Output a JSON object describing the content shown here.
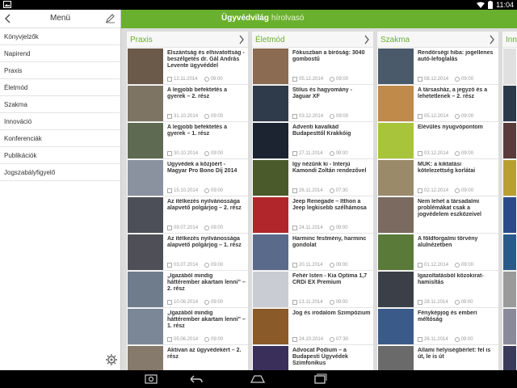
{
  "status": {
    "time": "11:04"
  },
  "drawer": {
    "title": "Menü",
    "items": [
      "Könyvjelzők",
      "Napirend",
      "Praxis",
      "Életmód",
      "Szakma",
      "Innováció",
      "Konferenciák",
      "Publikációk",
      "Jogszabályfigyelő"
    ]
  },
  "header": {
    "title": "Ügyvédvilág",
    "subtitle": "hírolvasó"
  },
  "columns": [
    {
      "title": "Praxis",
      "articles": [
        {
          "title": "Elszántság és elhivatottság - beszélgetés dr. Gál András Levente ügyvéddel",
          "date": "12.11.2014",
          "time": "09:00",
          "thumb": "#6b5a4a"
        },
        {
          "title": "A legjobb befektetés a gyerek – 2. rész",
          "date": "31.10.2014",
          "time": "09:00",
          "thumb": "#7d7463"
        },
        {
          "title": "A legjobb befektetés a gyerek – 1. rész",
          "date": "30.10.2014",
          "time": "09:00",
          "thumb": "#5e6a52"
        },
        {
          "title": "Ügyvédek a közjóért - Magyar Pro Bono Díj 2014",
          "date": "15.10.2014",
          "time": "09:00",
          "thumb": "#8a92a0"
        },
        {
          "title": "Az ítélkezés nyilvánossága alapvető polgárjog – 2. rész",
          "date": "09.07.2014",
          "time": "09:00",
          "thumb": "#4c4e58"
        },
        {
          "title": "Az ítélkezés nyilvánossága alapvető polgárjog – 1. rész",
          "date": "03.07.2014",
          "time": "09:00",
          "thumb": "#4f5057"
        },
        {
          "title": "„Igazából mindig háttérember akartam lenni” – 2. rész",
          "date": "10.06.2014",
          "time": "09:00",
          "thumb": "#6f7c8c"
        },
        {
          "title": "„Igazából mindig háttérember akartam lenni” – 1. rész",
          "date": "05.06.2014",
          "time": "09:00",
          "thumb": "#7b8796"
        },
        {
          "title": "Aktivan az ügyvédekért – 2. rész",
          "date": "",
          "time": "",
          "thumb": "#857a6c"
        }
      ]
    },
    {
      "title": "Életmód",
      "articles": [
        {
          "title": "Fókuszban a bíróság: 3040 gombostű",
          "date": "05.12.2014",
          "time": "09:00",
          "thumb": "#8b6b52"
        },
        {
          "title": "Stílus és hagyomány - Jaguar XF",
          "date": "03.12.2014",
          "time": "09:00",
          "thumb": "#2f3a4a"
        },
        {
          "title": "Adventi kavalkád Budapesttől Krakkóig",
          "date": "27.11.2014",
          "time": "09:00",
          "thumb": "#1b2430"
        },
        {
          "title": "Így nézünk ki - Interjú Kamondi Zoltán rendezővel",
          "date": "26.11.2014",
          "time": "07:30",
          "thumb": "#4a5a2a"
        },
        {
          "title": "Jeep Renegade – Itthon a Jeep legkisebb szélhámosa",
          "date": "24.11.2014",
          "time": "09:00",
          "thumb": "#b0262a"
        },
        {
          "title": "Harminc festmény, harminc gondolat",
          "date": "20.11.2014",
          "time": "09:00",
          "thumb": "#5a6a8a"
        },
        {
          "title": "Fehér Isten - Kia Optima 1,7 CRDi EX Premium",
          "date": "13.11.2014",
          "time": "09:00",
          "thumb": "#c9ccd2"
        },
        {
          "title": "Jog és irodalom Szimpózium",
          "date": "24.10.2014",
          "time": "07:30",
          "thumb": "#8a5a28"
        },
        {
          "title": "Advocat Podium – a Budapesti Ügyvédek Szimfonikus",
          "date": "",
          "time": "",
          "thumb": "#3a2f5a"
        }
      ]
    },
    {
      "title": "Szakma",
      "articles": [
        {
          "title": "Rendőrségi hiba: jogellenes autó-lefoglalás",
          "date": "08.12.2014",
          "time": "09:00",
          "thumb": "#4a5a6a"
        },
        {
          "title": "A társasház, a jegyző és a lehetetlenek – 2. rész",
          "date": "05.12.2014",
          "time": "09:00",
          "thumb": "#c08a4a"
        },
        {
          "title": "Elévülés nyugvópontom",
          "date": "03.12.2014",
          "time": "09:00",
          "thumb": "#a8c43a"
        },
        {
          "title": "MÜK: a kiktatási kötelezettség korlátai",
          "date": "02.12.2014",
          "time": "09:00",
          "thumb": "#9a8a6a"
        },
        {
          "title": "Nem lehet a társadalmi problémákat csak a jogvédelem eszközeivel kezelni",
          "date": "",
          "time": "",
          "thumb": "#7a6a60"
        },
        {
          "title": "A földforgalmi törvény alulnézetben",
          "date": "01.12.2014",
          "time": "09:00",
          "thumb": "#5a7a3a"
        },
        {
          "title": "Igazoltatásból közokirat-hamisítás",
          "date": "28.11.2014",
          "time": "09:00",
          "thumb": "#3a3f48"
        },
        {
          "title": "Fényképjog és emberi méltóság",
          "date": "26.11.2014",
          "time": "09:00",
          "thumb": "#3a5a8a"
        },
        {
          "title": "Állami helyiségbérlet: fel is út, le is út",
          "date": "",
          "time": "",
          "thumb": "#6a6a6a"
        }
      ]
    },
    {
      "title": "Inno",
      "articles": [
        {
          "title": "",
          "date": "",
          "time": "",
          "thumb": "#e0e0e0"
        },
        {
          "title": "",
          "date": "",
          "time": "",
          "thumb": "#2a3a4a"
        },
        {
          "title": "",
          "date": "",
          "time": "",
          "thumb": "#5a3a3a"
        },
        {
          "title": "",
          "date": "",
          "time": "",
          "thumb": "#b8a030"
        },
        {
          "title": "",
          "date": "",
          "time": "",
          "thumb": "#2a4a8a"
        },
        {
          "title": "",
          "date": "",
          "time": "",
          "thumb": "#2a5a8a"
        },
        {
          "title": "",
          "date": "",
          "time": "",
          "thumb": "#9a9a9a"
        },
        {
          "title": "",
          "date": "",
          "time": "",
          "thumb": "#8a8a9a"
        },
        {
          "title": "",
          "date": "",
          "time": "",
          "thumb": "#3a3a5a"
        }
      ]
    }
  ]
}
